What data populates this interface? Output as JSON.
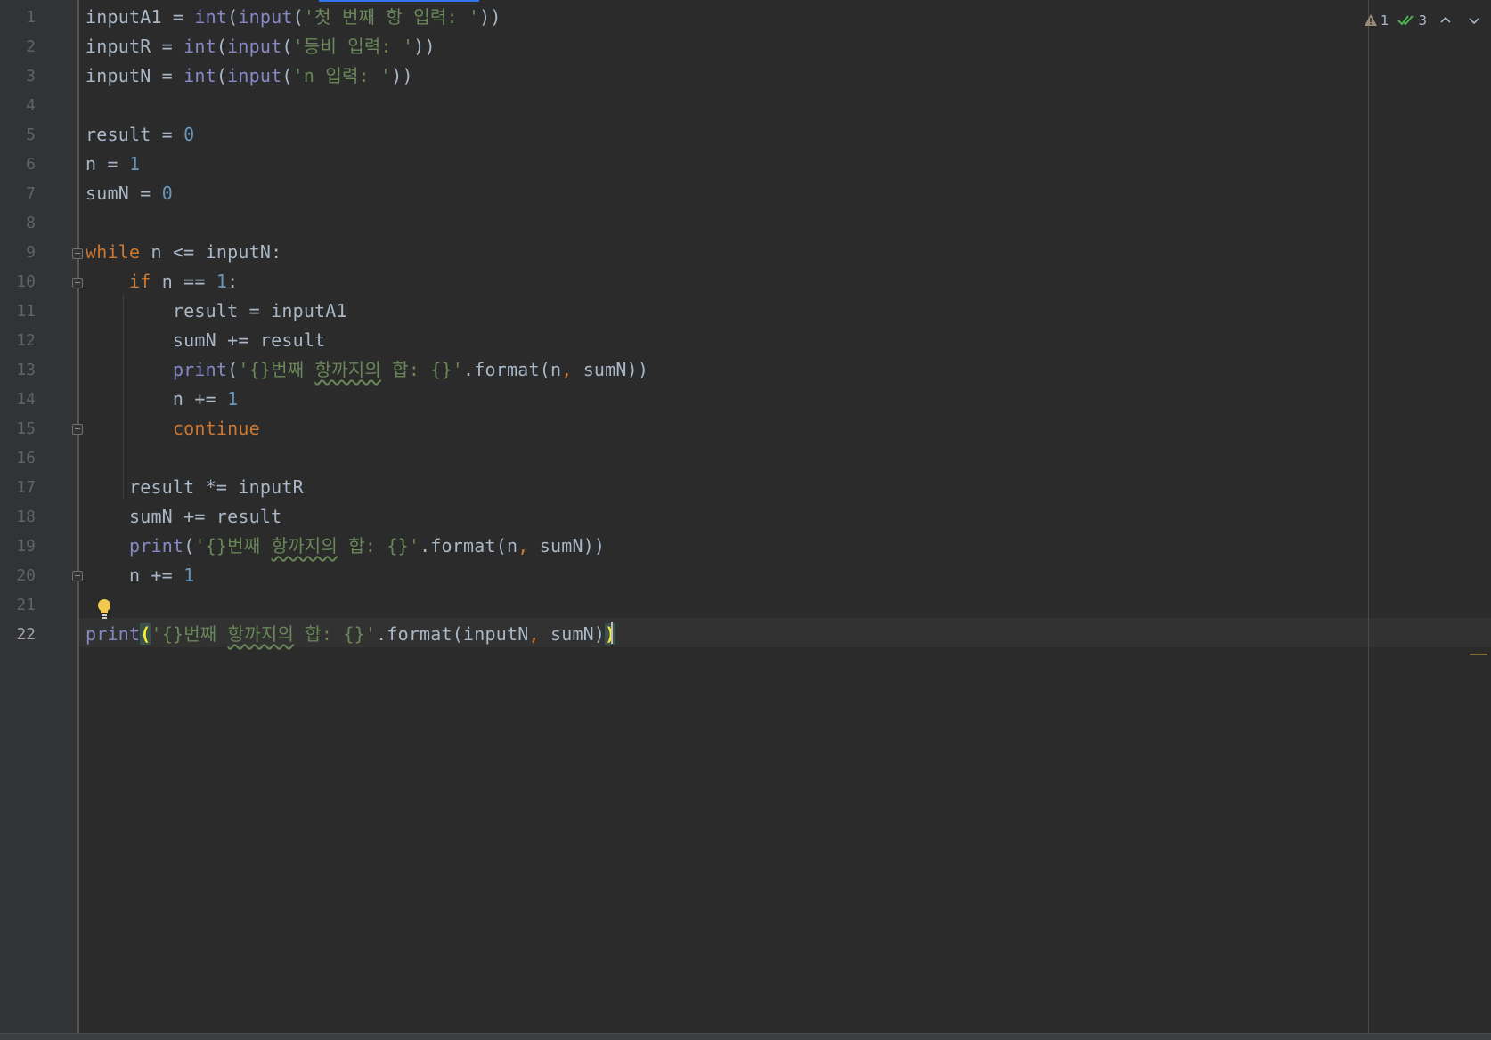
{
  "editor": {
    "current_line": 22,
    "inspections": {
      "warning_count": "1",
      "ok_count": "3",
      "warning_color": "#9a8c7a",
      "ok_color": "#4caf50",
      "prev_icon": "chevron-up-icon",
      "next_icon": "chevron-down-icon"
    },
    "lines": [
      {
        "num": "1",
        "tokens": [
          {
            "t": "inputA1 = ",
            "c": "plain"
          },
          {
            "t": "int",
            "c": "builtin"
          },
          {
            "t": "(",
            "c": "punc"
          },
          {
            "t": "input",
            "c": "builtin"
          },
          {
            "t": "(",
            "c": "punc"
          },
          {
            "t": "'첫 번째 항 입력: '",
            "c": "str"
          },
          {
            "t": "))",
            "c": "punc"
          }
        ]
      },
      {
        "num": "2",
        "tokens": [
          {
            "t": "inputR = ",
            "c": "plain"
          },
          {
            "t": "int",
            "c": "builtin"
          },
          {
            "t": "(",
            "c": "punc"
          },
          {
            "t": "input",
            "c": "builtin"
          },
          {
            "t": "(",
            "c": "punc"
          },
          {
            "t": "'등비 입력: '",
            "c": "str"
          },
          {
            "t": "))",
            "c": "punc"
          }
        ]
      },
      {
        "num": "3",
        "tokens": [
          {
            "t": "inputN = ",
            "c": "plain"
          },
          {
            "t": "int",
            "c": "builtin"
          },
          {
            "t": "(",
            "c": "punc"
          },
          {
            "t": "input",
            "c": "builtin"
          },
          {
            "t": "(",
            "c": "punc"
          },
          {
            "t": "'n 입력: '",
            "c": "str"
          },
          {
            "t": "))",
            "c": "punc"
          }
        ]
      },
      {
        "num": "4",
        "tokens": []
      },
      {
        "num": "5",
        "tokens": [
          {
            "t": "result = ",
            "c": "plain"
          },
          {
            "t": "0",
            "c": "num"
          }
        ]
      },
      {
        "num": "6",
        "tokens": [
          {
            "t": "n = ",
            "c": "plain"
          },
          {
            "t": "1",
            "c": "num"
          }
        ]
      },
      {
        "num": "7",
        "tokens": [
          {
            "t": "sumN = ",
            "c": "plain"
          },
          {
            "t": "0",
            "c": "num"
          }
        ]
      },
      {
        "num": "8",
        "tokens": []
      },
      {
        "num": "9",
        "tokens": [
          {
            "t": "while",
            "c": "kw"
          },
          {
            "t": " n <= inputN:",
            "c": "plain"
          }
        ]
      },
      {
        "num": "10",
        "tokens": [
          {
            "t": "    ",
            "c": "plain"
          },
          {
            "t": "if",
            "c": "kw"
          },
          {
            "t": " n == ",
            "c": "plain"
          },
          {
            "t": "1",
            "c": "num"
          },
          {
            "t": ":",
            "c": "plain"
          }
        ]
      },
      {
        "num": "11",
        "tokens": [
          {
            "t": "        result = inputA1",
            "c": "plain"
          }
        ]
      },
      {
        "num": "12",
        "tokens": [
          {
            "t": "        sumN += result",
            "c": "plain"
          }
        ]
      },
      {
        "num": "13",
        "tokens": [
          {
            "t": "        ",
            "c": "plain"
          },
          {
            "t": "print",
            "c": "builtin"
          },
          {
            "t": "(",
            "c": "punc"
          },
          {
            "t": "'{}번째 ",
            "c": "str"
          },
          {
            "t": "항까지의",
            "c": "str-wavy"
          },
          {
            "t": " 합: {}'",
            "c": "str"
          },
          {
            "t": ".format(n",
            "c": "plain"
          },
          {
            "t": ",",
            "c": "comma"
          },
          {
            "t": " sumN))",
            "c": "plain"
          }
        ]
      },
      {
        "num": "14",
        "tokens": [
          {
            "t": "        n += ",
            "c": "plain"
          },
          {
            "t": "1",
            "c": "num"
          }
        ]
      },
      {
        "num": "15",
        "tokens": [
          {
            "t": "        ",
            "c": "plain"
          },
          {
            "t": "continue",
            "c": "kw"
          }
        ]
      },
      {
        "num": "16",
        "tokens": []
      },
      {
        "num": "17",
        "tokens": [
          {
            "t": "    result *= inputR",
            "c": "plain"
          }
        ]
      },
      {
        "num": "18",
        "tokens": [
          {
            "t": "    sumN += result",
            "c": "plain"
          }
        ]
      },
      {
        "num": "19",
        "tokens": [
          {
            "t": "    ",
            "c": "plain"
          },
          {
            "t": "print",
            "c": "builtin"
          },
          {
            "t": "(",
            "c": "punc"
          },
          {
            "t": "'{}번째 ",
            "c": "str"
          },
          {
            "t": "항까지의",
            "c": "str-wavy"
          },
          {
            "t": " 합: {}'",
            "c": "str"
          },
          {
            "t": ".format(n",
            "c": "plain"
          },
          {
            "t": ",",
            "c": "comma"
          },
          {
            "t": " sumN))",
            "c": "plain"
          }
        ]
      },
      {
        "num": "20",
        "tokens": [
          {
            "t": "    n += ",
            "c": "plain"
          },
          {
            "t": "1",
            "c": "num"
          }
        ]
      },
      {
        "num": "21",
        "tokens": []
      },
      {
        "num": "22",
        "tokens": [
          {
            "t": "print",
            "c": "builtin"
          },
          {
            "t": "(",
            "c": "brace-hl"
          },
          {
            "t": "'{}번째 ",
            "c": "str"
          },
          {
            "t": "항까지의",
            "c": "str-wavy"
          },
          {
            "t": " 합: {}'",
            "c": "str"
          },
          {
            "t": ".format(inputN",
            "c": "plain"
          },
          {
            "t": ",",
            "c": "comma"
          },
          {
            "t": " sumN)",
            "c": "plain"
          },
          {
            "t": ")",
            "c": "brace-hl"
          }
        ]
      }
    ],
    "fold_lines": [
      9,
      10,
      15,
      20
    ],
    "intention_bulb_line": 21,
    "colors": {
      "background": "#2b2b2b",
      "keyword": "#cc7832",
      "builtin": "#8888c6",
      "string": "#6a8759",
      "number": "#6897bb",
      "plain": "#a9b7c6"
    }
  }
}
